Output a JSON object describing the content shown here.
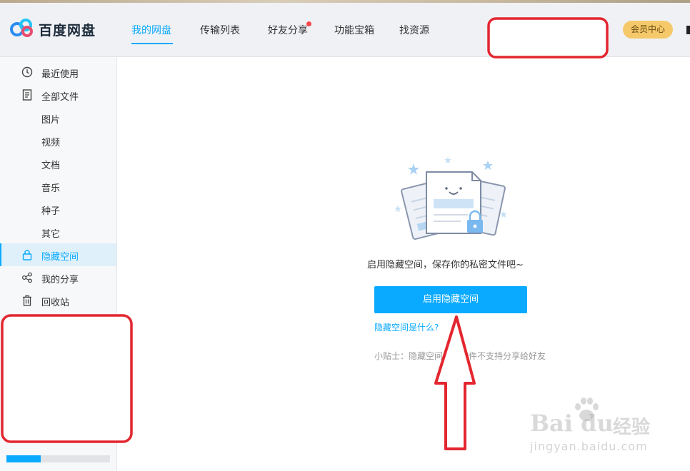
{
  "app": {
    "name": "百度网盘"
  },
  "nav": {
    "tabs": [
      {
        "label": "我的网盘",
        "active": true
      },
      {
        "label": "传输列表"
      },
      {
        "label": "好友分享",
        "badge": true
      },
      {
        "label": "功能宝箱"
      },
      {
        "label": "找资源"
      }
    ],
    "vip_label": "会员中心"
  },
  "sidebar": {
    "items": [
      {
        "label": "最近使用",
        "icon": "clock-icon"
      },
      {
        "label": "全部文件",
        "icon": "document-icon"
      },
      {
        "label": "图片"
      },
      {
        "label": "视频"
      },
      {
        "label": "文档"
      },
      {
        "label": "音乐"
      },
      {
        "label": "种子"
      },
      {
        "label": "其它"
      },
      {
        "label": "隐藏空间",
        "icon": "lock-icon",
        "active": true
      },
      {
        "label": "我的分享",
        "icon": "share-icon"
      },
      {
        "label": "回收站",
        "icon": "trash-icon"
      }
    ],
    "storage": {
      "used_fraction": 0.33,
      "text": "",
      "expand_label": ""
    }
  },
  "main": {
    "description": "启用隐藏空间，保存你的私密文件吧~",
    "enable_button": "启用隐藏空间",
    "what_link": "隐藏空间是什么?",
    "tip": "小贴士：隐藏空间中的文件不支持分享给好友"
  },
  "watermark": {
    "brand": "Bai du",
    "brand_cn": "经验",
    "url": "jingyan.baidu.com"
  },
  "colors": {
    "accent": "#09aaff",
    "vip": "#f5c96a",
    "annotation": "#e3262f",
    "header_bg": "#f0f1f5",
    "sidebar_bg": "#f7f8fa"
  }
}
